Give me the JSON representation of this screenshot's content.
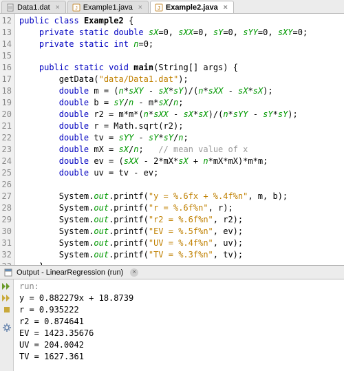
{
  "tabs": [
    {
      "label": "Data1.dat",
      "icon": "data-file-icon",
      "active": false
    },
    {
      "label": "Example1.java",
      "icon": "java-file-icon",
      "active": false
    },
    {
      "label": "Example2.java",
      "icon": "java-file-icon",
      "active": true
    }
  ],
  "editor": {
    "first_line": 12,
    "lines": [
      [
        [
          "kw",
          "public"
        ],
        [
          "",
          " "
        ],
        [
          "kw",
          "class"
        ],
        [
          "",
          " "
        ],
        [
          "bold",
          "Example2"
        ],
        [
          "",
          " {"
        ]
      ],
      [
        [
          "",
          "    "
        ],
        [
          "kw",
          "private"
        ],
        [
          "",
          " "
        ],
        [
          "kw",
          "static"
        ],
        [
          "",
          " "
        ],
        [
          "type",
          "double"
        ],
        [
          "",
          " "
        ],
        [
          "field",
          "sX"
        ],
        [
          "",
          "=0, "
        ],
        [
          "field",
          "sXX"
        ],
        [
          "",
          "=0, "
        ],
        [
          "field",
          "sY"
        ],
        [
          "",
          "=0, "
        ],
        [
          "field",
          "sYY"
        ],
        [
          "",
          "=0, "
        ],
        [
          "field",
          "sXY"
        ],
        [
          "",
          "=0;"
        ]
      ],
      [
        [
          "",
          "    "
        ],
        [
          "kw",
          "private"
        ],
        [
          "",
          " "
        ],
        [
          "kw",
          "static"
        ],
        [
          "",
          " "
        ],
        [
          "type",
          "int"
        ],
        [
          "",
          " "
        ],
        [
          "field",
          "n"
        ],
        [
          "",
          "=0;"
        ]
      ],
      [
        [
          "",
          ""
        ]
      ],
      [
        [
          "",
          "    "
        ],
        [
          "kw",
          "public"
        ],
        [
          "",
          " "
        ],
        [
          "kw",
          "static"
        ],
        [
          "",
          " "
        ],
        [
          "type",
          "void"
        ],
        [
          "",
          " "
        ],
        [
          "bold",
          "main"
        ],
        [
          "",
          "(String[] args) {"
        ]
      ],
      [
        [
          "",
          "        getData("
        ],
        [
          "str",
          "\"data/Data1.dat\""
        ],
        [
          "",
          ");"
        ]
      ],
      [
        [
          "",
          "        "
        ],
        [
          "type",
          "double"
        ],
        [
          "",
          " m = ("
        ],
        [
          "field",
          "n"
        ],
        [
          "",
          "*"
        ],
        [
          "field",
          "sXY"
        ],
        [
          "",
          " - "
        ],
        [
          "field",
          "sX"
        ],
        [
          "",
          "*"
        ],
        [
          "field",
          "sY"
        ],
        [
          "",
          ")/("
        ],
        [
          "field",
          "n"
        ],
        [
          "",
          "*"
        ],
        [
          "field",
          "sXX"
        ],
        [
          "",
          " - "
        ],
        [
          "field",
          "sX"
        ],
        [
          "",
          "*"
        ],
        [
          "field",
          "sX"
        ],
        [
          "",
          ");"
        ]
      ],
      [
        [
          "",
          "        "
        ],
        [
          "type",
          "double"
        ],
        [
          "",
          " b = "
        ],
        [
          "field",
          "sY"
        ],
        [
          "",
          "/"
        ],
        [
          "field",
          "n"
        ],
        [
          "",
          " - m*"
        ],
        [
          "field",
          "sX"
        ],
        [
          "",
          "/"
        ],
        [
          "field",
          "n"
        ],
        [
          "",
          ";"
        ]
      ],
      [
        [
          "",
          "        "
        ],
        [
          "type",
          "double"
        ],
        [
          "",
          " r2 = m*m*("
        ],
        [
          "field",
          "n"
        ],
        [
          "",
          "*"
        ],
        [
          "field",
          "sXX"
        ],
        [
          "",
          " - "
        ],
        [
          "field",
          "sX"
        ],
        [
          "",
          "*"
        ],
        [
          "field",
          "sX"
        ],
        [
          "",
          ")/("
        ],
        [
          "field",
          "n"
        ],
        [
          "",
          "*"
        ],
        [
          "field",
          "sYY"
        ],
        [
          "",
          " - "
        ],
        [
          "field",
          "sY"
        ],
        [
          "",
          "*"
        ],
        [
          "field",
          "sY"
        ],
        [
          "",
          ");"
        ]
      ],
      [
        [
          "",
          "        "
        ],
        [
          "type",
          "double"
        ],
        [
          "",
          " r = Math.sqrt(r2);"
        ]
      ],
      [
        [
          "",
          "        "
        ],
        [
          "type",
          "double"
        ],
        [
          "",
          " tv = "
        ],
        [
          "field",
          "sYY"
        ],
        [
          "",
          " - "
        ],
        [
          "field",
          "sY"
        ],
        [
          "",
          "*"
        ],
        [
          "field",
          "sY"
        ],
        [
          "",
          "/"
        ],
        [
          "field",
          "n"
        ],
        [
          "",
          ";"
        ]
      ],
      [
        [
          "",
          "        "
        ],
        [
          "type",
          "double"
        ],
        [
          "",
          " mX = "
        ],
        [
          "field",
          "sX"
        ],
        [
          "",
          "/"
        ],
        [
          "field",
          "n"
        ],
        [
          "",
          ";   "
        ],
        [
          "com",
          "// mean value of x"
        ]
      ],
      [
        [
          "",
          "        "
        ],
        [
          "type",
          "double"
        ],
        [
          "",
          " ev = ("
        ],
        [
          "field",
          "sXX"
        ],
        [
          "",
          " - 2*mX*"
        ],
        [
          "field",
          "sX"
        ],
        [
          "",
          " + "
        ],
        [
          "field",
          "n"
        ],
        [
          "",
          "*mX*mX)*m*m;"
        ]
      ],
      [
        [
          "",
          "        "
        ],
        [
          "type",
          "double"
        ],
        [
          "",
          " uv = tv - ev;"
        ]
      ],
      [
        [
          "",
          ""
        ]
      ],
      [
        [
          "",
          "        System."
        ],
        [
          "field",
          "out"
        ],
        [
          "",
          ".printf("
        ],
        [
          "str",
          "\"y = %.6fx + %.4f%n\""
        ],
        [
          "",
          ", m, b);"
        ]
      ],
      [
        [
          "",
          "        System."
        ],
        [
          "field",
          "out"
        ],
        [
          "",
          ".printf("
        ],
        [
          "str",
          "\"r = %.6f%n\""
        ],
        [
          "",
          ", r);"
        ]
      ],
      [
        [
          "",
          "        System."
        ],
        [
          "field",
          "out"
        ],
        [
          "",
          ".printf("
        ],
        [
          "str",
          "\"r2 = %.6f%n\""
        ],
        [
          "",
          ", r2);"
        ]
      ],
      [
        [
          "",
          "        System."
        ],
        [
          "field",
          "out"
        ],
        [
          "",
          ".printf("
        ],
        [
          "str",
          "\"EV = %.5f%n\""
        ],
        [
          "",
          ", ev);"
        ]
      ],
      [
        [
          "",
          "        System."
        ],
        [
          "field",
          "out"
        ],
        [
          "",
          ".printf("
        ],
        [
          "str",
          "\"UV = %.4f%n\""
        ],
        [
          "",
          ", uv);"
        ]
      ],
      [
        [
          "",
          "        System."
        ],
        [
          "field",
          "out"
        ],
        [
          "",
          ".printf("
        ],
        [
          "str",
          "\"TV = %.3f%n\""
        ],
        [
          "",
          ", tv);"
        ]
      ],
      [
        [
          "",
          "    }"
        ]
      ]
    ]
  },
  "output": {
    "title": "Output - LinearRegression (run)",
    "run_label": "run:",
    "lines": [
      "y = 0.882279x + 18.8739",
      "r = 0.935222",
      "r2 = 0.874641",
      "EV = 1423.35676",
      "UV = 204.0042",
      "TV = 1627.361"
    ]
  }
}
